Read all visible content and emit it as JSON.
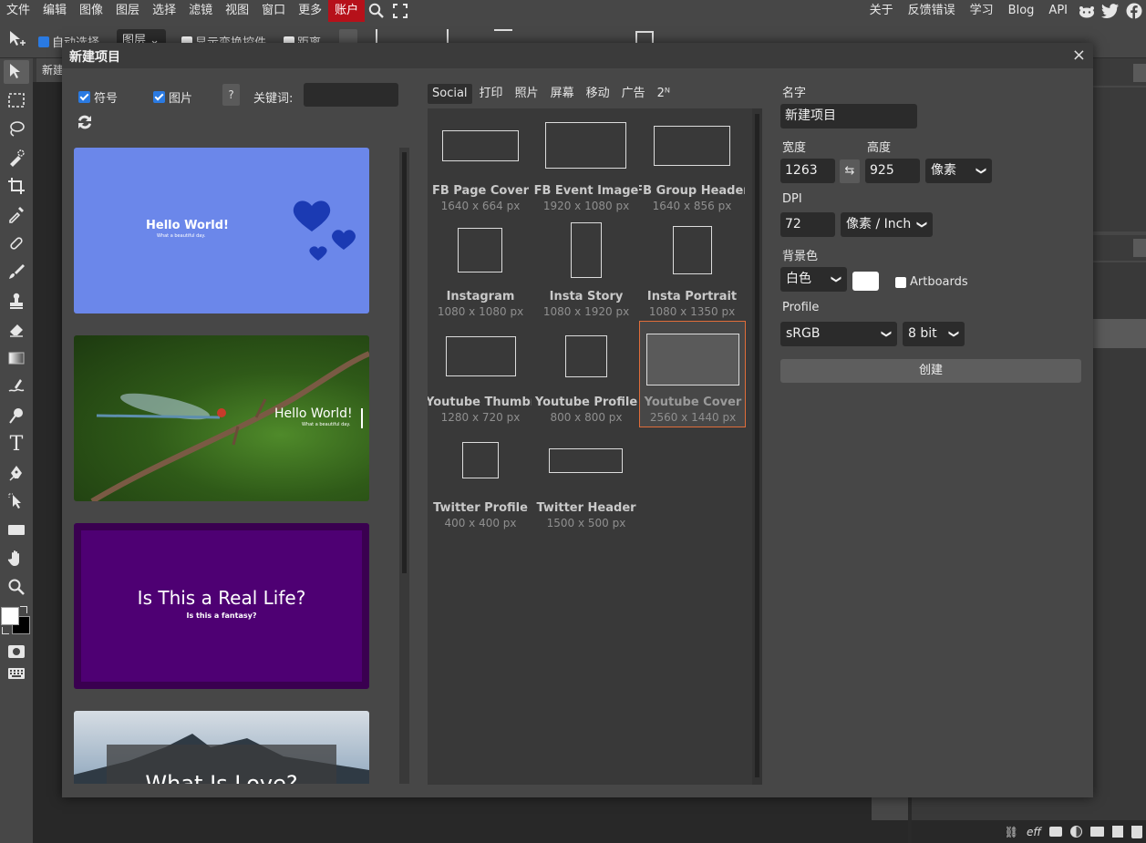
{
  "menu": {
    "items": [
      "文件",
      "编辑",
      "图像",
      "图层",
      "选择",
      "滤镜",
      "视图",
      "窗口",
      "更多"
    ],
    "account": "账户",
    "right_items": [
      "关于",
      "反馈错误",
      "学习",
      "Blog",
      "API"
    ]
  },
  "options_bar": {
    "auto_select_label": "自动选择",
    "layer_select_value": "图层",
    "show_transform_label": "显示变换控件",
    "distance_label": "距离"
  },
  "doc_tab": {
    "title": "新建"
  },
  "dialog": {
    "title": "新建项目",
    "close": "×",
    "symbols_label": "符号",
    "images_label": "图片",
    "help_label": "?",
    "keyword_label": "关键词:",
    "keyword_value": "",
    "templates": [
      {
        "title": "Hello World!",
        "subtitle": "What a beautiful day.",
        "bg": "#6b87ea"
      },
      {
        "title": "Hello World!",
        "subtitle": "What a beautiful day.",
        "bg": "#3f6a22"
      },
      {
        "title": "Is This a Real Life?",
        "subtitle": "Is this a fantasy?",
        "bg": "#4b0066"
      },
      {
        "title": "What Is Love?",
        "subtitle": "",
        "bg": "#8aa6c2"
      }
    ],
    "preset_tabs": [
      "Social",
      "打印",
      "照片",
      "屏幕",
      "移动",
      "广告",
      "2ᴺ"
    ],
    "active_tab": "Social",
    "presets": [
      {
        "name": "FB Page Cover",
        "dims": "1640 x 664 px"
      },
      {
        "name": "FB Event Image",
        "dims": "1920 x 1080 px"
      },
      {
        "name": "FB Group Header",
        "dims": "1640 x 856 px"
      },
      {
        "name": "Instagram",
        "dims": "1080 x 1080 px"
      },
      {
        "name": "Insta Story",
        "dims": "1080 x 1920 px"
      },
      {
        "name": "Insta Portrait",
        "dims": "1080 x 1350 px"
      },
      {
        "name": "Youtube Thumbnail",
        "dims": "1280 x 720 px"
      },
      {
        "name": "Youtube Profile",
        "dims": "800 x 800 px"
      },
      {
        "name": "Youtube Cover",
        "dims": "2560 x 1440 px"
      },
      {
        "name": "Twitter Profile",
        "dims": "400 x 400 px"
      },
      {
        "name": "Twitter Header",
        "dims": "1500 x 500 px"
      }
    ],
    "selected_preset": "Youtube Cover",
    "form": {
      "name_label": "名字",
      "name_value": "新建项目",
      "width_label": "宽度",
      "width_value": "1263",
      "height_label": "高度",
      "height_value": "925",
      "unit_value": "像素",
      "dpi_label": "DPI",
      "dpi_value": "72",
      "dpi_unit_value": "像素 / Inch",
      "bg_label": "背景色",
      "bg_value": "白色",
      "bg_color": "#ffffff",
      "artboards_label": "Artboards",
      "profile_label": "Profile",
      "profile_value": "sRGB",
      "bitdepth_value": "8 bit",
      "create_label": "创建"
    }
  },
  "colors": {
    "accent": "#2a7ae2",
    "account_red": "#b6111a",
    "selected_border": "#e06d3a",
    "panel": "#474747",
    "dark": "#393939"
  }
}
